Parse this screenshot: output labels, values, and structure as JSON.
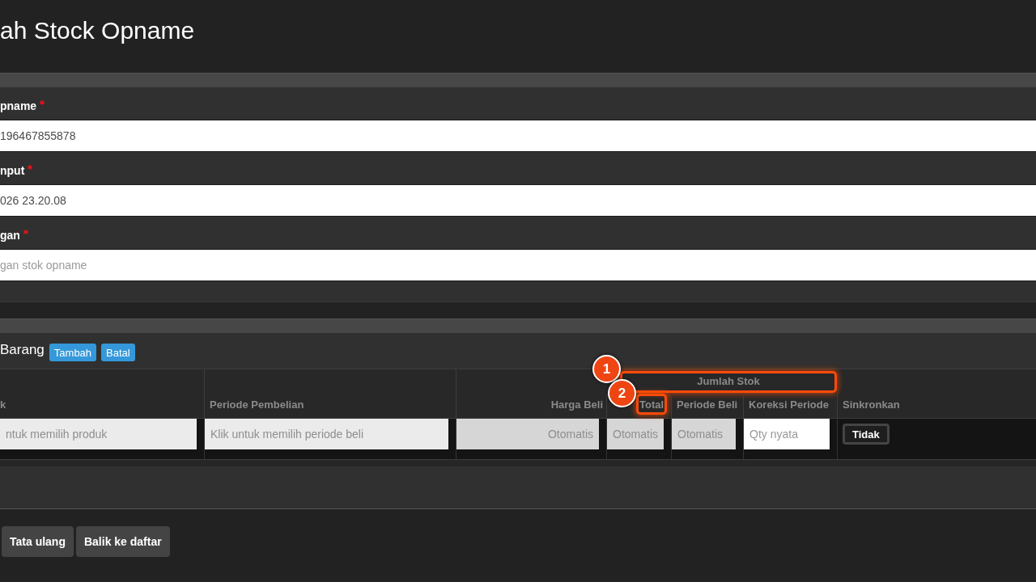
{
  "page": {
    "title": "ah Stock Opname"
  },
  "form": {
    "fields": [
      {
        "label": "pname",
        "required": true,
        "value": "196467855878"
      },
      {
        "label": "nput",
        "required": true,
        "value": "026 23.20.08"
      },
      {
        "label": "gan",
        "required": true,
        "placeholder": "gan stok opname"
      }
    ]
  },
  "items": {
    "title": "Barang",
    "buttons": [
      "Tambah",
      "Batal"
    ],
    "table": {
      "group_heading": {
        "label": "Jumlah Stok",
        "callout": "1"
      },
      "columns": [
        {
          "label": "k"
        },
        {
          "label": "Periode Pembelian"
        },
        {
          "label": "Harga Beli"
        },
        {
          "label": "Total",
          "callout": "2"
        },
        {
          "label": "Periode Beli"
        },
        {
          "label": "Koreksi Periode"
        },
        {
          "label": "Sinkronkan"
        }
      ],
      "rows": [
        {
          "cells": [
            {
              "kind": "picker",
              "placeholder": "ntuk memilih produk"
            },
            {
              "kind": "picker",
              "placeholder": "Klik untuk memilih periode beli"
            },
            {
              "kind": "currency",
              "placeholder": "Otomatis"
            },
            {
              "kind": "auto",
              "placeholder": "Otomatis"
            },
            {
              "kind": "auto",
              "placeholder": "Otomatis"
            },
            {
              "kind": "quantity",
              "placeholder": "Qty nyata"
            },
            {
              "kind": "toggle",
              "label": "Tidak",
              "on": false
            }
          ]
        }
      ]
    }
  },
  "actions": [
    "Tata ulang",
    "Balik ke daftar"
  ]
}
